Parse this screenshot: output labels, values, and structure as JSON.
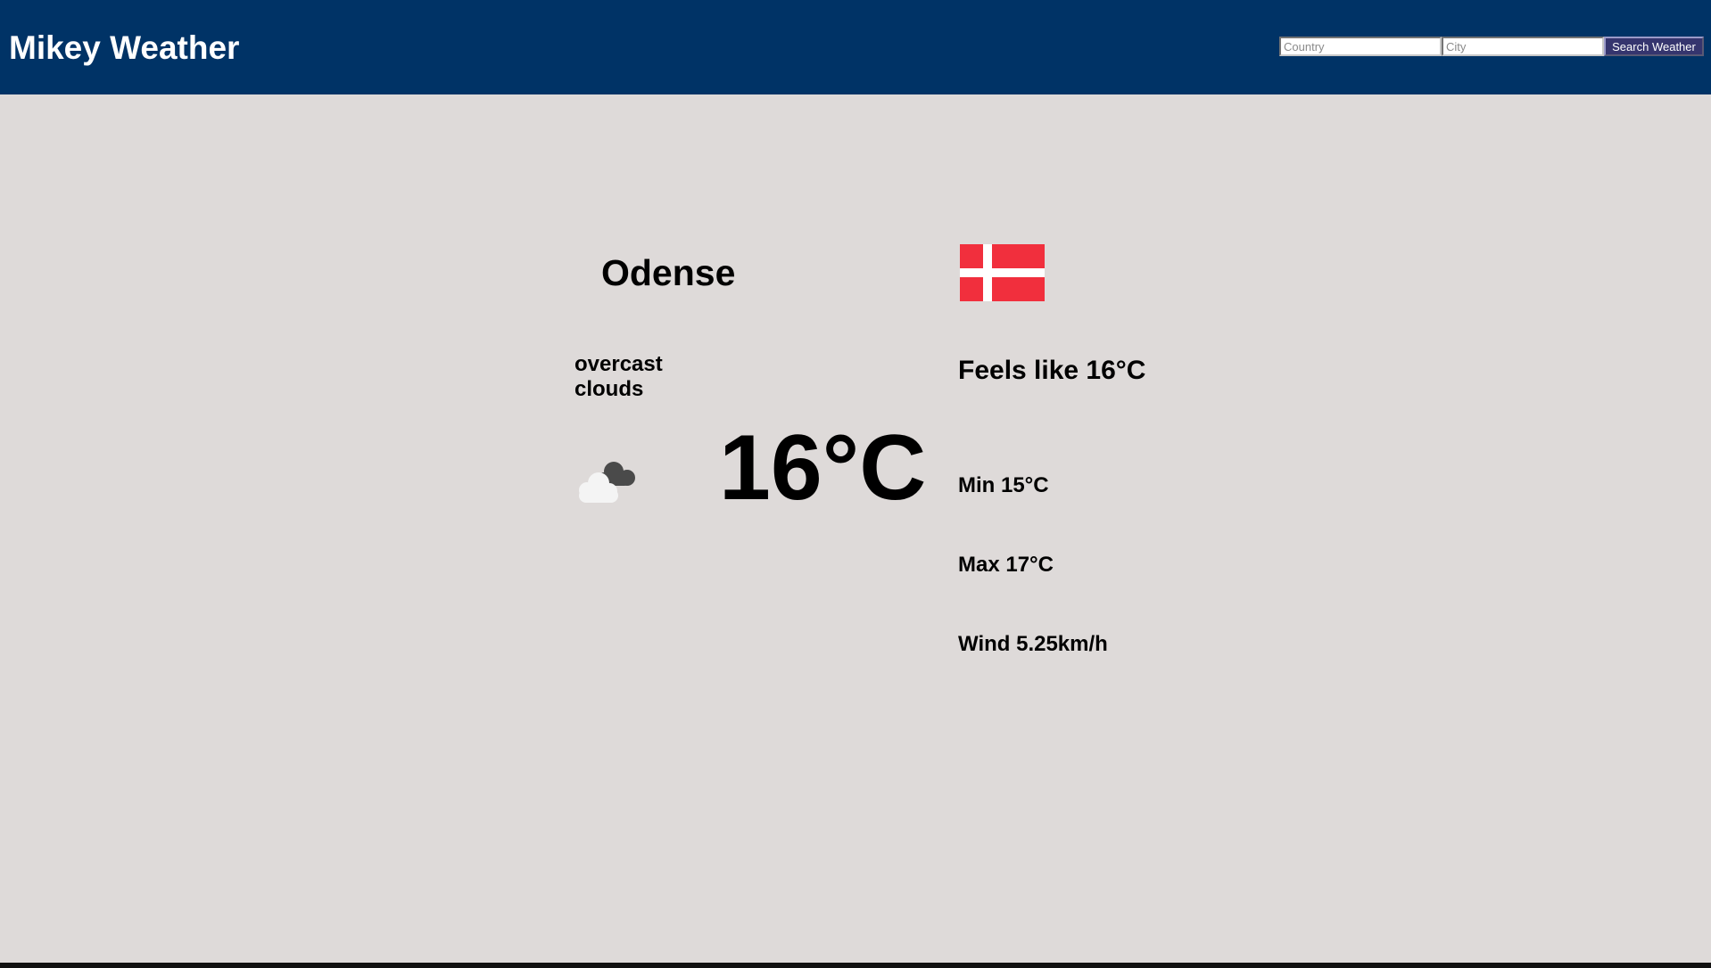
{
  "header": {
    "title": "Mikey Weather",
    "bg_color": "#003366"
  },
  "search": {
    "country_placeholder": "Country",
    "country_value": "",
    "city_placeholder": "City",
    "city_value": "",
    "button_label": "Search Weather"
  },
  "weather": {
    "city": "Odense",
    "country_flag": "denmark-flag",
    "description": "overcast clouds",
    "icon": "overcast-clouds-icon",
    "temperature": "16°C",
    "feels_like": "Feels like 16°C",
    "min": "Min 15°C",
    "max": "Max 17°C",
    "wind": "Wind 5.25km/h"
  },
  "colors": {
    "page_bg": "#dedad9",
    "flag_red": "#f12f3d",
    "flag_white": "#ffffff",
    "button_bg": "#35356e"
  }
}
